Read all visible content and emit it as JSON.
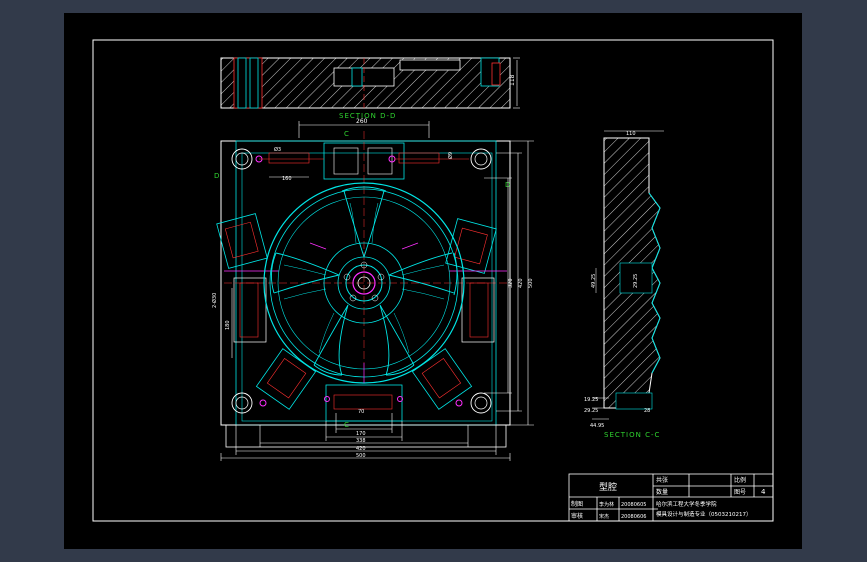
{
  "drawing": {
    "section_dd_label": "SECTION D-D",
    "section_cc_label": "SECTION C-C",
    "marker_c": "C",
    "marker_d": "D",
    "dims": {
      "top_width": "260",
      "top_inner": "160",
      "left_small": "Ø3",
      "right_small": "Ø9",
      "bottom_a": "70",
      "bottom_b": "170",
      "bottom_c": "338",
      "bottom_d": "420",
      "bottom_e": "500",
      "right_a": "500",
      "right_b": "420",
      "right_c": "320",
      "left_a": "180",
      "left_b": "2-Ø30",
      "side_top": "110",
      "side_mid1": "49.25",
      "side_mid2": "29.25",
      "side_bot1": "19.25",
      "side_bot2": "29.25",
      "side_bot3": "44.95",
      "side_right": "28",
      "section_height": "118"
    }
  },
  "title_block": {
    "part_name": "型腔",
    "weight_label": "共张",
    "scale_label": "比例",
    "qty_label": "数量",
    "sheet_label": "图号",
    "sheet_no": "4",
    "drawn_label": "制图",
    "drawn_name": "李为林",
    "drawn_date": "20080605",
    "check_label": "审核",
    "check_name": "宋杰",
    "check_date": "20080606",
    "school_line1": "哈尔滨工程大学冬季学院",
    "school_line2": "模具设计与制造专业（0503210217）"
  },
  "colors": {
    "line_white": "#ffffff",
    "line_cyan": "#00e5e5",
    "line_magenta": "#ff2fff",
    "line_red": "#ff3030",
    "line_green": "#2fd22f",
    "line_gray": "#8c8c8c"
  }
}
